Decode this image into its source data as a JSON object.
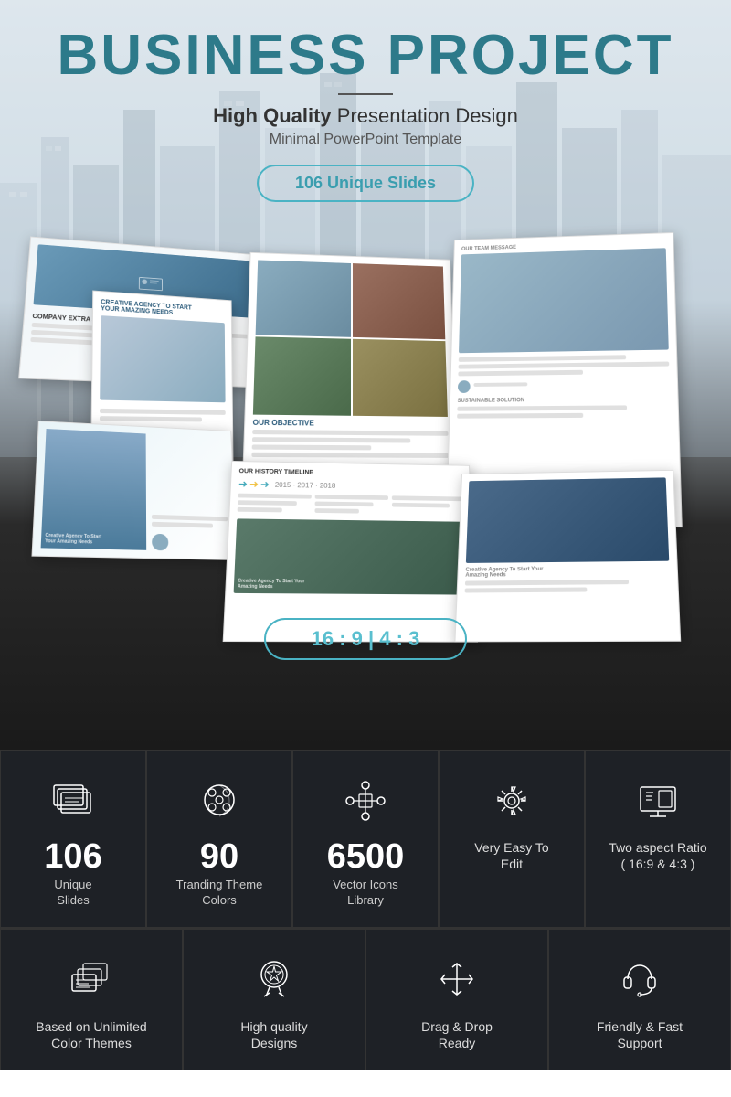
{
  "header": {
    "title": "BUSINESS PROJECT",
    "subtitle_bold": "High Quality",
    "subtitle_rest": " Presentation Design",
    "tagline": "Minimal PowerPoint Template",
    "slides_badge": "106 Unique Slides",
    "ratio_badge": "16 : 9  |  4 : 3"
  },
  "features_top": [
    {
      "number": "106",
      "label": "Unique\nSlides",
      "icon": "slides-icon"
    },
    {
      "number": "90",
      "label": "Tranding Theme\nColors",
      "icon": "palette-icon"
    },
    {
      "number": "6500",
      "label": "Vector Icons\nLibrary",
      "icon": "vector-icon"
    },
    {
      "number": "",
      "label": "Very Easy To\nEdit",
      "icon": "gear-icon"
    },
    {
      "number": "",
      "label": "Two aspect Ratio\n( 16:9 & 4:3 )",
      "icon": "monitor-icon"
    }
  ],
  "features_bottom": [
    {
      "label": "Based on Unlimited\nColor Themes",
      "icon": "cards-icon"
    },
    {
      "label": "High quality\nDesigns",
      "icon": "award-icon"
    },
    {
      "label": "Drag & Drop\nReady",
      "icon": "drag-icon"
    },
    {
      "label": "Friendly & Fast\nSupport",
      "icon": "headset-icon"
    }
  ]
}
